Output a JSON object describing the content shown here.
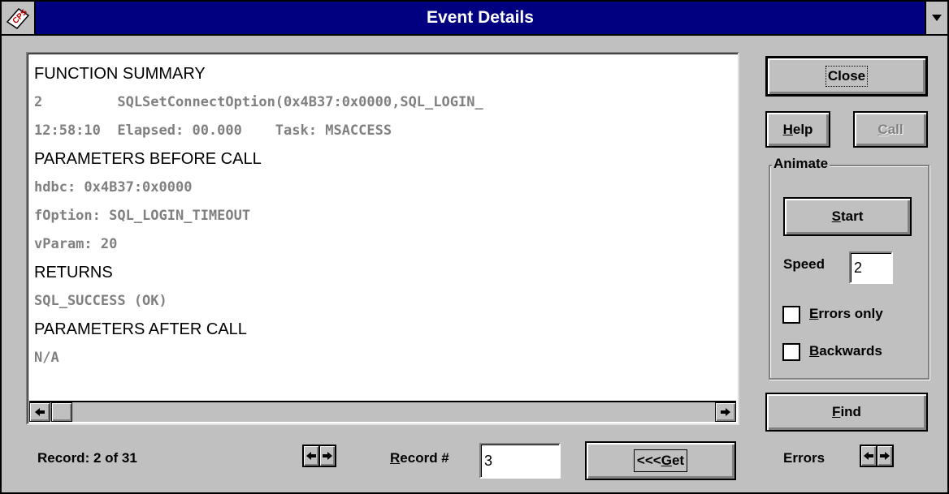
{
  "window": {
    "title": "Event Details"
  },
  "lines": [
    {
      "text": "FUNCTION SUMMARY",
      "style": "heading"
    },
    {
      "text": "2         SQLSetConnectOption(0x4B37:0x0000,SQL_LOGIN_",
      "style": "mono"
    },
    {
      "text": "12:58:10  Elapsed: 00.000    Task: MSACCESS",
      "style": "mono"
    },
    {
      "text": "PARAMETERS BEFORE CALL",
      "style": "heading"
    },
    {
      "text": "hdbc: 0x4B37:0x0000",
      "style": "mono"
    },
    {
      "text": "fOption: SQL_LOGIN_TIMEOUT",
      "style": "mono"
    },
    {
      "text": "vParam: 20",
      "style": "mono"
    },
    {
      "text": "RETURNS",
      "style": "heading"
    },
    {
      "text": "SQL_SUCCESS (OK)",
      "style": "mono"
    },
    {
      "text": "PARAMETERS AFTER CALL",
      "style": "heading"
    },
    {
      "text": "N/A",
      "style": "mono"
    }
  ],
  "buttons": {
    "close": "Close",
    "help_mnemonic": "H",
    "help_rest": "elp",
    "call_mnemonic": "C",
    "call_rest": "all",
    "start_mnemonic": "S",
    "start_rest": "tart",
    "find_mnemonic": "F",
    "find_rest": "ind",
    "get_prefix": "<<<",
    "get_mnemonic": "G",
    "get_rest": "et"
  },
  "animate": {
    "group_label": "Animate",
    "speed_label": "Speed",
    "speed_value": "2",
    "errors_only_mnemonic": "E",
    "errors_only_rest": "rrors only",
    "errors_only_checked": false,
    "backwards_mnemonic": "B",
    "backwards_rest": "ackwards",
    "backwards_checked": false
  },
  "footer": {
    "record_status": "Record: 2 of 31",
    "record_num_mnemonic": "R",
    "record_num_rest": "ecord #",
    "record_num_value": "3",
    "errors_label": "Errors"
  },
  "icons": {
    "sysmenu": "cps-icon",
    "dropdown": "triangle-down-icon",
    "arrow_left": "arrow-left-icon",
    "arrow_right": "arrow-right-icon"
  },
  "colors": {
    "titlebar": "#000080",
    "face": "#c0c0c0",
    "gray_text": "#808080"
  }
}
